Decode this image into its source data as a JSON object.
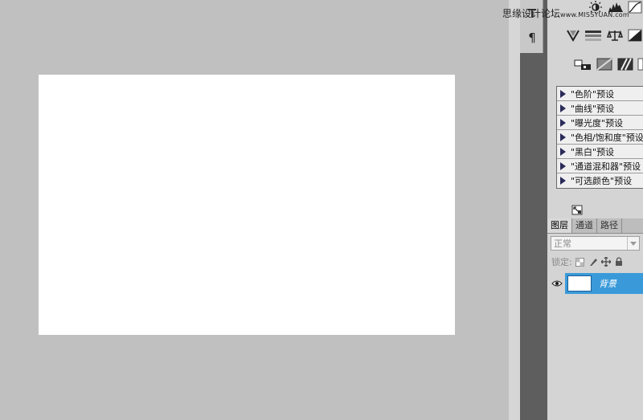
{
  "watermark": {
    "site_name": "思缘设计论坛",
    "url": "www.MISSYUAN.com"
  },
  "strip": {
    "paragraph_glyph": "¶"
  },
  "adjustments": {
    "icons": [
      "brightness-contrast-icon",
      "levels-icon",
      "curves-icon",
      "vibrance-icon",
      "hue-saturation-icon",
      "color-balance-icon",
      "black-white-icon",
      "photo-filter-icon",
      "channel-mixer-icon",
      "invert-icon"
    ]
  },
  "presets": [
    {
      "label": "\"色阶\"预设"
    },
    {
      "label": "\"曲线\"预设"
    },
    {
      "label": "\"曝光度\"预设"
    },
    {
      "label": "\"色相/饱和度\"预设"
    },
    {
      "label": "\"黑白\"预设"
    },
    {
      "label": "\"通道混和器\"预设"
    },
    {
      "label": "\"可选颜色\"预设"
    }
  ],
  "layers_panel": {
    "tabs": [
      "图层",
      "通道",
      "路径"
    ],
    "active_tab": 0,
    "blend_mode": "正常",
    "lock_label": "锁定:",
    "layer": {
      "name": "背景",
      "visible": true
    }
  },
  "colors": {
    "canvas_bg": "#c0c0c0",
    "document": "#ffffff",
    "selection": "#3a9ad9"
  }
}
